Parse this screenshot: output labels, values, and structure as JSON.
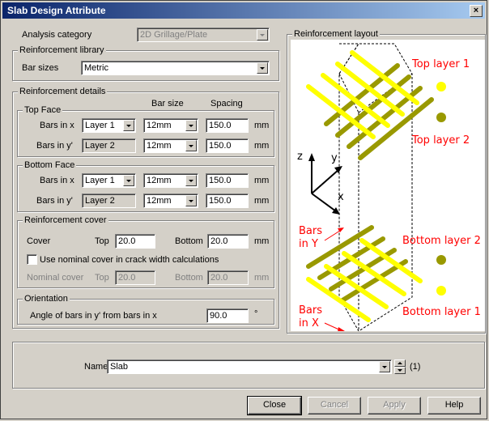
{
  "window": {
    "title": "Slab Design Attribute"
  },
  "analysis": {
    "label": "Analysis category",
    "value": "2D Grillage/Plate"
  },
  "library": {
    "legend": "Reinforcement library",
    "bar_sizes_label": "Bar sizes",
    "bar_sizes_value": "Metric"
  },
  "details": {
    "legend": "Reinforcement details",
    "col_bar_size": "Bar size",
    "col_spacing": "Spacing",
    "top_face": {
      "legend": "Top Face",
      "bars_x_label": "Bars in x",
      "bars_x_layer": "Layer 1",
      "bars_x_size": "12mm",
      "bars_x_spacing": "150.0",
      "bars_x_unit": "mm",
      "bars_y_label": "Bars in y'",
      "bars_y_layer": "Layer 2",
      "bars_y_size": "12mm",
      "bars_y_spacing": "150.0",
      "bars_y_unit": "mm"
    },
    "bottom_face": {
      "legend": "Bottom Face",
      "bars_x_label": "Bars in x",
      "bars_x_layer": "Layer 1",
      "bars_x_size": "12mm",
      "bars_x_spacing": "150.0",
      "bars_x_unit": "mm",
      "bars_y_label": "Bars in y'",
      "bars_y_layer": "Layer 2",
      "bars_y_size": "12mm",
      "bars_y_spacing": "150.0",
      "bars_y_unit": "mm"
    },
    "cover": {
      "legend": "Reinforcement cover",
      "cover_label": "Cover",
      "top_label": "Top",
      "top_value": "20.0",
      "bottom_label": "Bottom",
      "bottom_value": "20.0",
      "unit": "mm",
      "nominal_check_label": "Use nominal cover in crack width calculations",
      "nominal_label": "Nominal cover",
      "nominal_top_label": "Top",
      "nominal_top_value": "20.0",
      "nominal_bottom_label": "Bottom",
      "nominal_bottom_value": "20.0",
      "nominal_unit": "mm"
    },
    "orientation": {
      "legend": "Orientation",
      "angle_label": "Angle of bars in y' from bars in x",
      "angle_value": "90.0",
      "angle_unit": "°"
    }
  },
  "layout": {
    "legend": "Reinforcement layout",
    "top_layer_1": "Top layer 1",
    "top_layer_2": "Top layer 2",
    "bottom_layer_2": "Bottom layer 2",
    "bottom_layer_1": "Bottom layer 1",
    "bars_in_y_1": "Bars",
    "bars_in_y_2": "in Y",
    "bars_in_x_1": "Bars",
    "bars_in_x_2": "in X",
    "axis_z": "z",
    "axis_y": "y",
    "axis_x": "x",
    "colors": {
      "layer1": "#ffff00",
      "layer2": "#999900",
      "label": "#ff0000",
      "arrow": "#ff0000"
    }
  },
  "name_row": {
    "label": "Name",
    "value": "Slab",
    "count": "(1)"
  },
  "buttons": {
    "close": "Close",
    "cancel": "Cancel",
    "apply": "Apply",
    "help": "Help"
  }
}
